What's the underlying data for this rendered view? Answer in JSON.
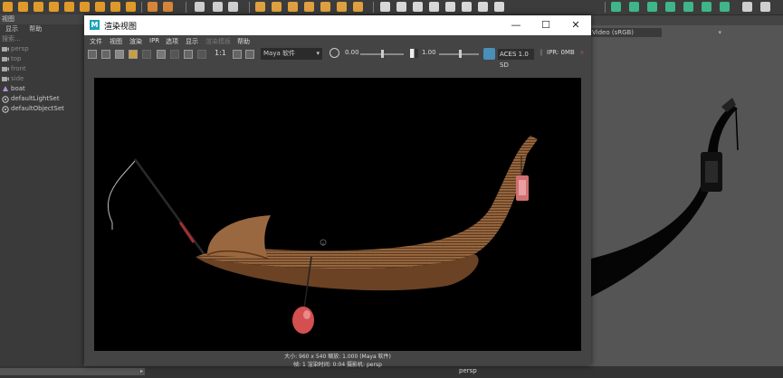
{
  "maya": {
    "outliner": {
      "menu": [
        "视图"
      ],
      "submenu": [
        "显示",
        "帮助"
      ],
      "search_placeholder": "搜索...",
      "items": [
        {
          "label": "persp",
          "icon": "camera-icon",
          "dim": true
        },
        {
          "label": "top",
          "icon": "camera-icon",
          "dim": true
        },
        {
          "label": "front",
          "icon": "camera-icon",
          "dim": true
        },
        {
          "label": "side",
          "icon": "camera-icon",
          "dim": true
        },
        {
          "label": "boat",
          "icon": "mesh-icon",
          "dim": false
        },
        {
          "label": "defaultLightSet",
          "icon": "set-icon",
          "dim": false
        },
        {
          "label": "defaultObjectSet",
          "icon": "set-icon",
          "dim": false
        }
      ]
    },
    "viewport": {
      "color_space_label": "Video (sRGB)",
      "camera_label": "persp"
    }
  },
  "render_view": {
    "title": "渲染视图",
    "logo": "M",
    "window_controls": {
      "minimize": "—",
      "maximize": "☐",
      "close": "✕"
    },
    "menus": [
      "文件",
      "视图",
      "渲染",
      "IPR",
      "选项",
      "显示",
      "渲染模板",
      "帮助"
    ],
    "toolbar": {
      "ratio_label": "1:1",
      "renderer": "Maya 软件",
      "exposure": "0.00",
      "gamma": "1.00",
      "colorspace": "ACES 1.0 SD",
      "ipr_memory": "IPR: 0MB"
    },
    "info": {
      "line1": "大小: 960 x 540  缩放: 1.000        (Maya 软件)",
      "line2": "帧: 1        渲染时间: 0:04        摄影机: persp"
    }
  },
  "colors": {
    "accent": "#1ba3b8",
    "canvas_bg": "#000000",
    "wood": "#8a5a35",
    "lantern": "#d07070"
  }
}
